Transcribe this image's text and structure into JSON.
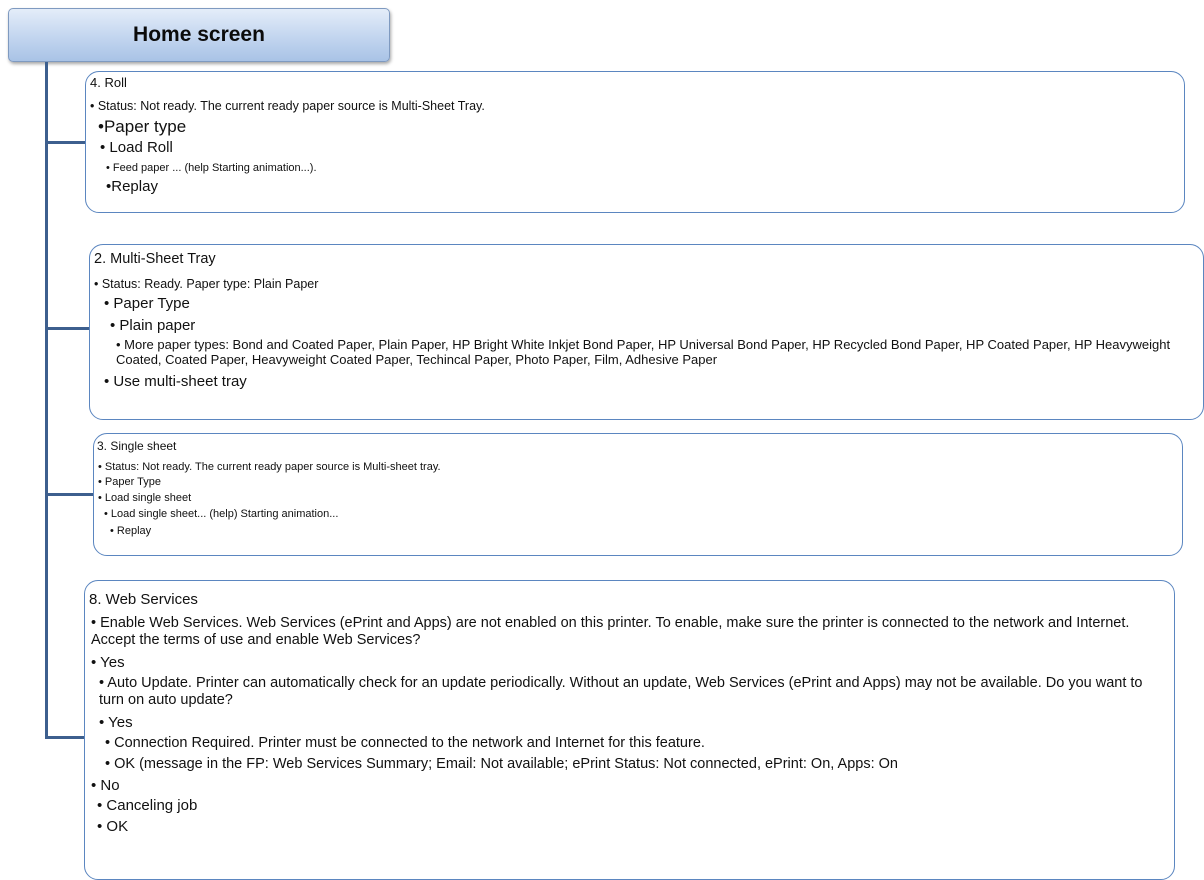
{
  "header": {
    "title": "Home screen"
  },
  "roll": {
    "title": "4. Roll",
    "status": "• Status: Not ready. The current ready paper source is Multi-Sheet Tray.",
    "paper_type": "•Paper type",
    "load_roll": "• Load Roll",
    "feed_paper": "• Feed paper   ... (help Starting animation...).",
    "replay": "•Replay"
  },
  "multi": {
    "title": "2. Multi-Sheet Tray",
    "status": "• Status: Ready. Paper type: Plain Paper",
    "paper_type": "• Paper Type",
    "plain_paper": "• Plain paper",
    "more_types": "• More paper types:  Bond and Coated Paper, Plain Paper, HP Bright White Inkjet Bond Paper, HP Universal Bond  Paper, HP Recycled Bond Paper, HP Coated Paper, HP Heavyweight Coated, Coated Paper, Heavyweight Coated Paper, Techincal Paper, Photo Paper, Film, Adhesive Paper",
    "use_tray": "• Use multi-sheet tray"
  },
  "single": {
    "title": "3. Single sheet",
    "status": "• Status: Not ready. The current ready paper source is Multi-sheet tray.",
    "paper_type": "• Paper Type",
    "load_single": "• Load single sheet",
    "load_help": "• Load single sheet... (help) Starting animation...",
    "replay": "• Replay"
  },
  "web": {
    "title": "8. Web Services",
    "enable": "• Enable Web Services. Web Services (ePrint and Apps) are not enabled on this printer. To enable, make sure the printer is connected to the network and Internet. Accept the terms of use and enable Web Services?",
    "yes1": "• Yes",
    "auto_update": "• Auto Update. Printer can automatically check for an update periodically. Without an update, Web Services (ePrint and Apps) may not be available. Do you want to turn on auto update?",
    "yes2": "• Yes",
    "connection": "• Connection Required. Printer must be connected to the network and Internet for this feature.",
    "ok_msg": "• OK (message in the FP: Web Services Summary; Email: Not available; ePrint Status: Not connected, ePrint: On, Apps: On",
    "no": "• No",
    "canceling": "• Canceling job",
    "ok": "• OK"
  }
}
